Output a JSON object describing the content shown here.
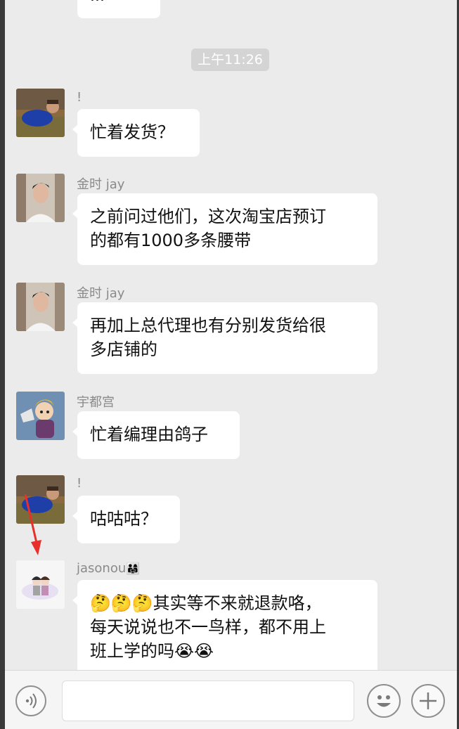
{
  "top_partial_message": "...",
  "timestamp": "上午11:26",
  "messages": [
    {
      "sender": "!",
      "text": "忙着发货？"
    },
    {
      "sender": "金时 jay",
      "line1": "之前问过他们，这次淘宝店预订",
      "line2": "的都有1000多条腰带"
    },
    {
      "sender": "金时 jay",
      "line1": "再加上总代理也有分别发货给很",
      "line2": "多店铺的"
    },
    {
      "sender": "宇都宫",
      "text": "忙着编理由鸽子"
    },
    {
      "sender": "!",
      "text": "咕咕咕？"
    },
    {
      "sender": "jasonou",
      "sender_emoji": "👨‍👩‍👧",
      "line1": "🤔🤔🤔其实等不来就退款咯，",
      "line2": "每天说说也不一鸟样，都不用上",
      "line3": "班上学的吗😭😭"
    }
  ],
  "input_bar": {
    "voice_icon": "voice-icon",
    "emoji_icon": "emoji-icon",
    "plus_icon": "plus-icon",
    "input_value": ""
  },
  "colors": {
    "annotation_arrow": "#e8302a",
    "bubble": "#ffffff",
    "background": "#ebebeb"
  }
}
